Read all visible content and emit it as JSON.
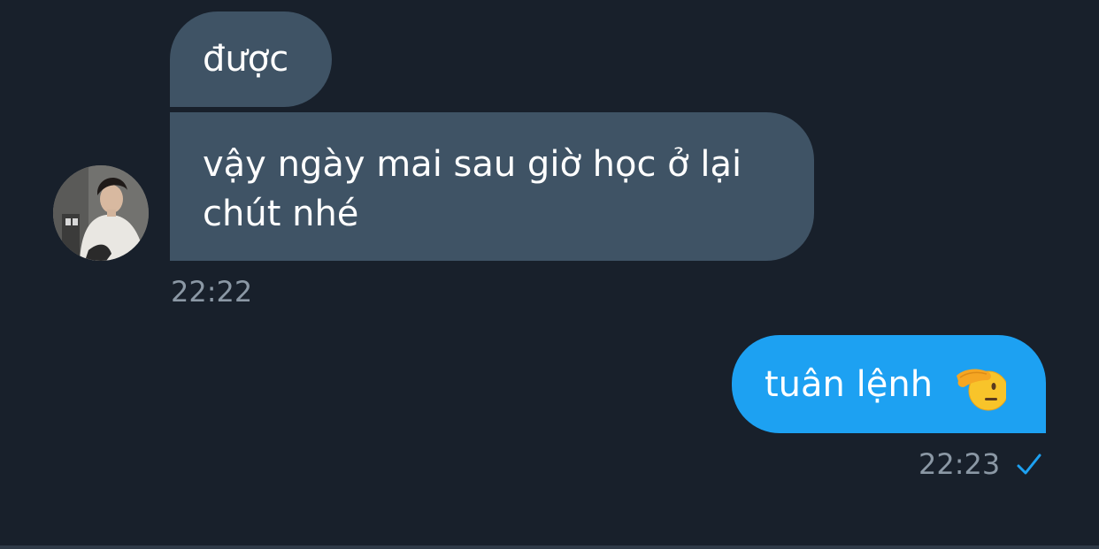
{
  "conversation": {
    "messages": [
      {
        "direction": "incoming",
        "text": "được"
      },
      {
        "direction": "incoming",
        "text": "vậy ngày mai sau giờ học ở lại chút nhé"
      },
      {
        "direction": "outgoing",
        "text": "tuân lệnh",
        "emoji": "saluting-face-emoji"
      }
    ],
    "incoming_time": "22:22",
    "outgoing_time": "22:23",
    "outgoing_status_icon": "checkmark-icon",
    "avatar_icon": "user-avatar-photo"
  },
  "colors": {
    "background": "#18202b",
    "incoming_bubble": "#3f5365",
    "outgoing_bubble": "#1da1f2",
    "timestamp": "#8b98a5",
    "checkmark": "#1da1f2"
  }
}
